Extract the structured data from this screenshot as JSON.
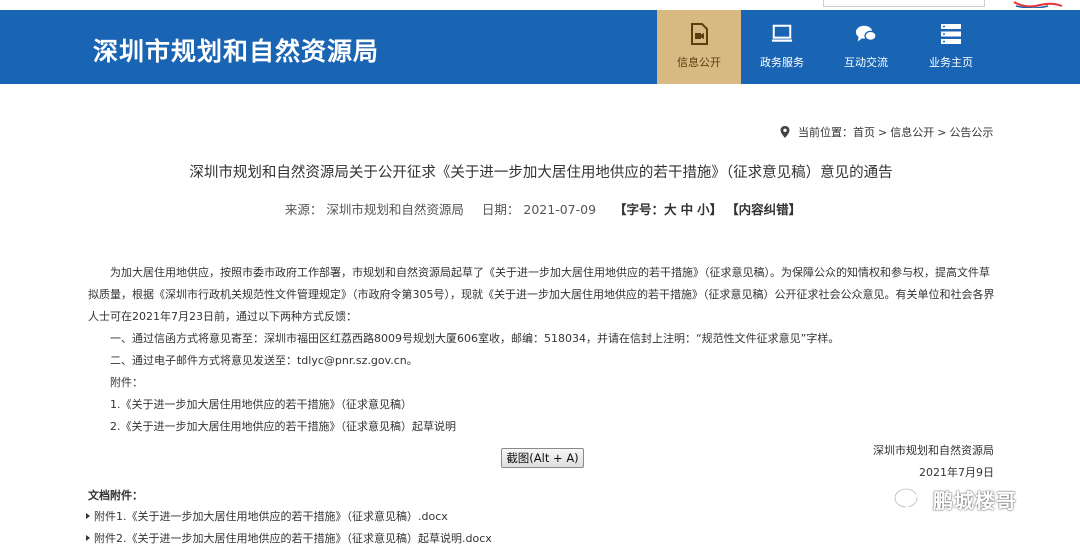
{
  "header": {
    "site_title": "深圳市规划和自然资源局",
    "nav": [
      {
        "label": "信息公开",
        "icon": "document-video-icon",
        "active": true
      },
      {
        "label": "政务服务",
        "icon": "monitor-icon",
        "active": false
      },
      {
        "label": "互动交流",
        "icon": "chat-bubbles-icon",
        "active": false
      },
      {
        "label": "业务主页",
        "icon": "server-list-icon",
        "active": false
      }
    ]
  },
  "breadcrumb": {
    "prefix": "当前位置：",
    "items": [
      "首页",
      "信息公开",
      "公告公示"
    ],
    "separator": ">"
  },
  "article": {
    "title": "深圳市规划和自然资源局关于公开征求《关于进一步加大居住用地供应的若干措施》（征求意见稿）意见的通告",
    "meta": {
      "source_label": "来源：",
      "source": "深圳市规划和自然资源局",
      "date_label": "日期：",
      "date": "2021-07-09",
      "font_size_label": "【字号：",
      "font_sizes": [
        "大",
        "中",
        "小"
      ],
      "font_size_close": "】",
      "correction": "【内容纠错】"
    },
    "paragraphs": [
      "为加大居住用地供应，按照市委市政府工作部署，市规划和自然资源局起草了《关于进一步加大居住用地供应的若干措施》（征求意见稿）。为保障公众的知情权和参与权，提高文件草拟质量，根据《深圳市行政机关规范性文件管理规定》（市政府令第305号），现就《关于进一步加大居住用地供应的若干措施》（征求意见稿）公开征求社会公众意见。有关单位和社会各界人士可在2021年7月23日前，通过以下两种方式反馈：",
      "一、通过信函方式将意见寄至：深圳市福田区红荔西路8009号规划大厦606室收，邮编：518034，并请在信封上注明：“规范性文件征求意见”字样。",
      "二、通过电子邮件方式将意见发送至：tdlyc@pnr.sz.gov.cn。",
      "附件：",
      "1.《关于进一步加大居住用地供应的若干措施》（征求意见稿）",
      "2.《关于进一步加大居住用地供应的若干措施》（征求意见稿）起草说明"
    ],
    "signature_org": "深圳市规划和自然资源局",
    "signature_date": "2021年7月9日",
    "screenshot_button": "截图(Alt + A)",
    "attachments_title": "文档附件：",
    "attachments": [
      "附件1.《关于进一步加大居住用地供应的若干措施》（征求意见稿）.docx",
      "附件2.《关于进一步加大居住用地供应的若干措施》（征求意见稿）起草说明.docx"
    ]
  },
  "watermark": {
    "text": "鹏城楼哥",
    "icon": "wechat-icon"
  },
  "colors": {
    "header_bg": "#1a64b4",
    "nav_active_bg": "#d9b982"
  }
}
